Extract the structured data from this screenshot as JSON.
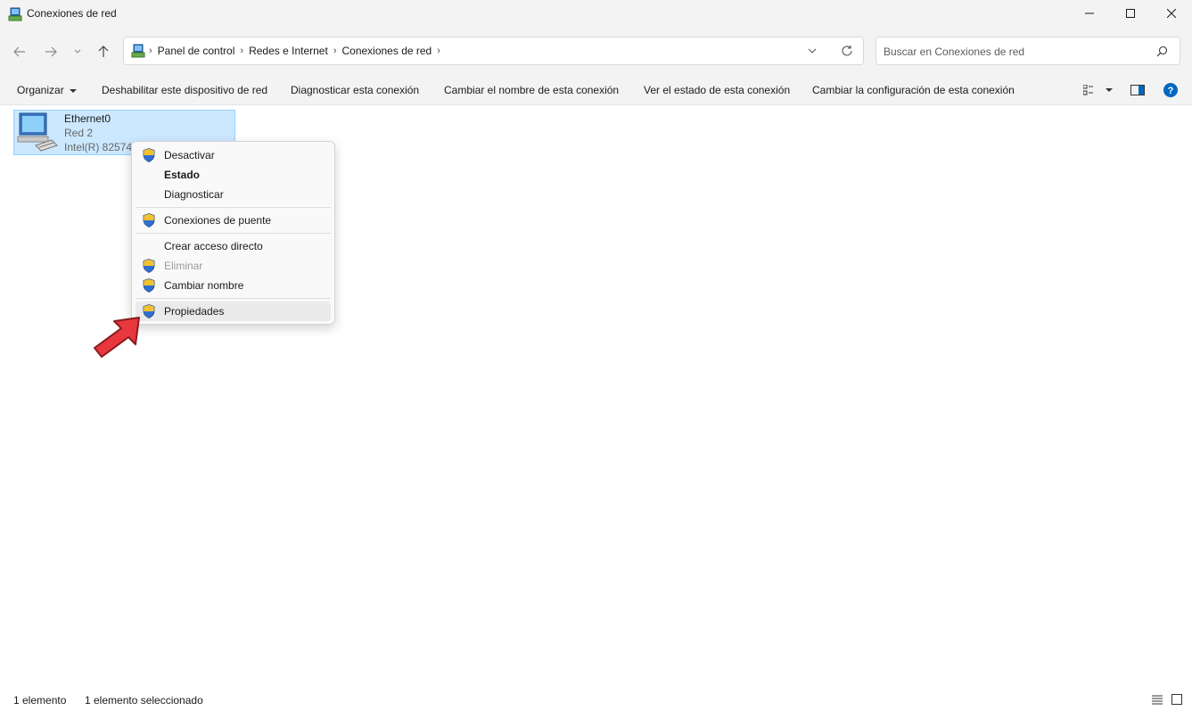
{
  "window": {
    "title": "Conexiones de red",
    "minimize_icon": "minimize-icon",
    "maximize_icon": "maximize-icon",
    "close_icon": "close-icon"
  },
  "nav": {
    "breadcrumbs": [
      "Panel de control",
      "Redes e Internet",
      "Conexiones de red"
    ],
    "search_placeholder": "Buscar en Conexiones de red"
  },
  "commands": {
    "organize": "Organizar",
    "disable": "Deshabilitar este dispositivo de red",
    "diagnose": "Diagnosticar esta conexión",
    "rename": "Cambiar el nombre de esta conexión",
    "status": "Ver el estado de esta conexión",
    "settings": "Cambiar la configuración de esta conexión"
  },
  "connection": {
    "name": "Ethernet0",
    "network": "Red 2",
    "device": "Intel(R) 82574L"
  },
  "context_menu": {
    "items": [
      {
        "label": "Desactivar",
        "icon": "uac-shield-icon"
      },
      {
        "label": "Estado"
      },
      {
        "label": "Diagnosticar"
      },
      {
        "label": "Conexiones de puente",
        "icon": "uac-shield-icon"
      },
      {
        "label": "Crear acceso directo"
      },
      {
        "label": "Eliminar",
        "icon": "uac-shield-icon",
        "disabled": true
      },
      {
        "label": "Cambiar nombre",
        "icon": "uac-shield-icon"
      },
      {
        "label": "Propiedades",
        "icon": "uac-shield-icon",
        "highlighted": true
      }
    ]
  },
  "status_bar": {
    "count": "1 elemento",
    "selected": "1 elemento seleccionado"
  },
  "colors": {
    "selection_bg": "#cce8ff",
    "selection_border": "#99d1ff",
    "arrow": "#e8383d",
    "help": "#0067c0"
  }
}
